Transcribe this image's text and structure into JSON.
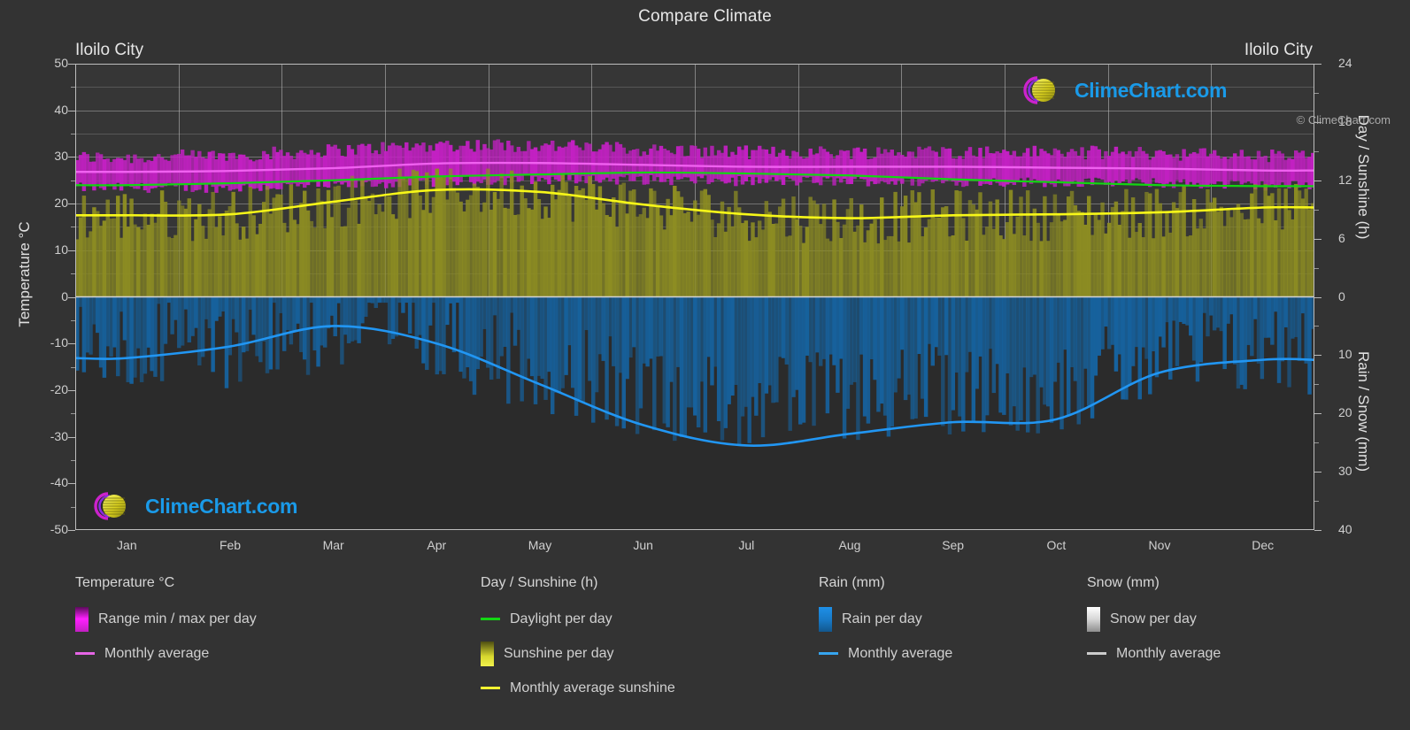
{
  "header": {
    "main_title": "Compare Climate",
    "left_city": "Iloilo City",
    "right_city": "Iloilo City"
  },
  "axes": {
    "left_label": "Temperature °C",
    "right_top_label": "Day / Sunshine (h)",
    "right_bottom_label": "Rain / Snow (mm)",
    "left_ticks": [
      "50",
      "40",
      "30",
      "20",
      "10",
      "0",
      "-10",
      "-20",
      "-30",
      "-40",
      "-50"
    ],
    "right_top_ticks": [
      "24",
      "18",
      "12",
      "6",
      "0"
    ],
    "right_bottom_ticks": [
      "0",
      "10",
      "20",
      "30",
      "40"
    ],
    "x_ticks": [
      "Jan",
      "Feb",
      "Mar",
      "Apr",
      "May",
      "Jun",
      "Jul",
      "Aug",
      "Sep",
      "Oct",
      "Nov",
      "Dec"
    ]
  },
  "watermark": {
    "text": "ClimeChart.com",
    "copyright": "© ClimeChart.com"
  },
  "legend": {
    "columns": [
      {
        "title": "Temperature °C",
        "items": [
          {
            "label": "Range min / max per day",
            "type": "band",
            "color": "#d320d3"
          },
          {
            "label": "Monthly average",
            "type": "line",
            "color": "#e565e5"
          }
        ]
      },
      {
        "title": "Day / Sunshine (h)",
        "items": [
          {
            "label": "Daylight per day",
            "type": "line",
            "color": "#13d613"
          },
          {
            "label": "Sunshine per day",
            "type": "band",
            "color": "#e8e83a"
          },
          {
            "label": "Monthly average sunshine",
            "type": "line",
            "color": "#f2f231"
          }
        ]
      },
      {
        "title": "Rain (mm)",
        "items": [
          {
            "label": "Rain per day",
            "type": "band",
            "color": "#1f8fe0"
          },
          {
            "label": "Monthly average",
            "type": "line",
            "color": "#36a5ef"
          }
        ]
      },
      {
        "title": "Snow (mm)",
        "items": [
          {
            "label": "Snow per day",
            "type": "band",
            "color": "#e8e8e8"
          },
          {
            "label": "Monthly average",
            "type": "line",
            "color": "#cccccc"
          }
        ]
      }
    ]
  },
  "colors": {
    "background": "#333333",
    "plot_background": "#363636",
    "grid": "#8d8d8d",
    "temp_band": "#c420c4",
    "temp_avg_line": "#f060f0",
    "daylight_line": "#12d612",
    "sunshine_fill": "#8d8d22",
    "sunshine_avg_line": "#f7f718",
    "rain_fill": "#16629e",
    "rain_avg_line": "#2196f3",
    "text": "#d8d8d8"
  },
  "chart_data": {
    "type": "area",
    "title": "Compare Climate",
    "subtitle": "Iloilo City",
    "xlabel": "",
    "ylabel": "Temperature °C",
    "ylabel_right_top": "Day / Sunshine (h)",
    "ylabel_right_bottom": "Rain / Snow (mm)",
    "grid": true,
    "legend_position": "bottom",
    "categories": [
      "Jan",
      "Feb",
      "Mar",
      "Apr",
      "May",
      "Jun",
      "Jul",
      "Aug",
      "Sep",
      "Oct",
      "Nov",
      "Dec"
    ],
    "axis_temperature": {
      "min": -50,
      "max": 50,
      "step": 10,
      "unit": "°C"
    },
    "axis_day_sunshine": {
      "min": 0,
      "max": 24,
      "step": 6,
      "unit": "h",
      "region": "upper-half"
    },
    "axis_rain_snow": {
      "min": 0,
      "max": 40,
      "step": 10,
      "unit": "mm",
      "region": "lower-half"
    },
    "series": [
      {
        "name": "Monthly average temperature",
        "unit": "°C",
        "axis": "temperature",
        "color": "#f060f0",
        "values": [
          26.8,
          27.0,
          27.6,
          28.6,
          28.7,
          28.3,
          27.9,
          27.9,
          27.9,
          27.7,
          27.5,
          27.1
        ]
      },
      {
        "name": "Range min per day (monthly mean of daily minimum)",
        "unit": "°C",
        "axis": "temperature",
        "color": "#c420c4",
        "values": [
          23.4,
          23.4,
          23.9,
          24.7,
          25.2,
          25.1,
          24.8,
          24.8,
          24.7,
          24.6,
          24.4,
          23.9
        ]
      },
      {
        "name": "Range max per day (monthly mean of daily maximum)",
        "unit": "°C",
        "axis": "temperature",
        "color": "#c420c4",
        "values": [
          29.9,
          30.3,
          31.4,
          32.6,
          32.5,
          31.6,
          31.0,
          31.0,
          31.1,
          31.0,
          30.8,
          30.2
        ]
      },
      {
        "name": "Daylight per day",
        "unit": "h",
        "axis": "day_sunshine",
        "color": "#12d612",
        "values": [
          11.5,
          11.7,
          12.0,
          12.4,
          12.6,
          12.8,
          12.7,
          12.5,
          12.1,
          11.8,
          11.5,
          11.4
        ]
      },
      {
        "name": "Monthly average sunshine",
        "unit": "h",
        "axis": "day_sunshine",
        "color": "#f7f718",
        "values": [
          8.4,
          8.5,
          9.8,
          11.0,
          10.8,
          9.5,
          8.5,
          8.1,
          8.4,
          8.5,
          8.7,
          9.2
        ]
      },
      {
        "name": "Rain monthly average",
        "unit": "mm",
        "axis": "rain_snow",
        "color": "#2196f3",
        "values": [
          10.5,
          8.5,
          5.0,
          8.0,
          15.0,
          22.0,
          25.5,
          23.5,
          21.5,
          21.0,
          13.0,
          10.8
        ]
      },
      {
        "name": "Snow monthly average",
        "unit": "mm",
        "axis": "rain_snow",
        "color": "#cccccc",
        "values": [
          0,
          0,
          0,
          0,
          0,
          0,
          0,
          0,
          0,
          0,
          0,
          0
        ]
      }
    ]
  }
}
